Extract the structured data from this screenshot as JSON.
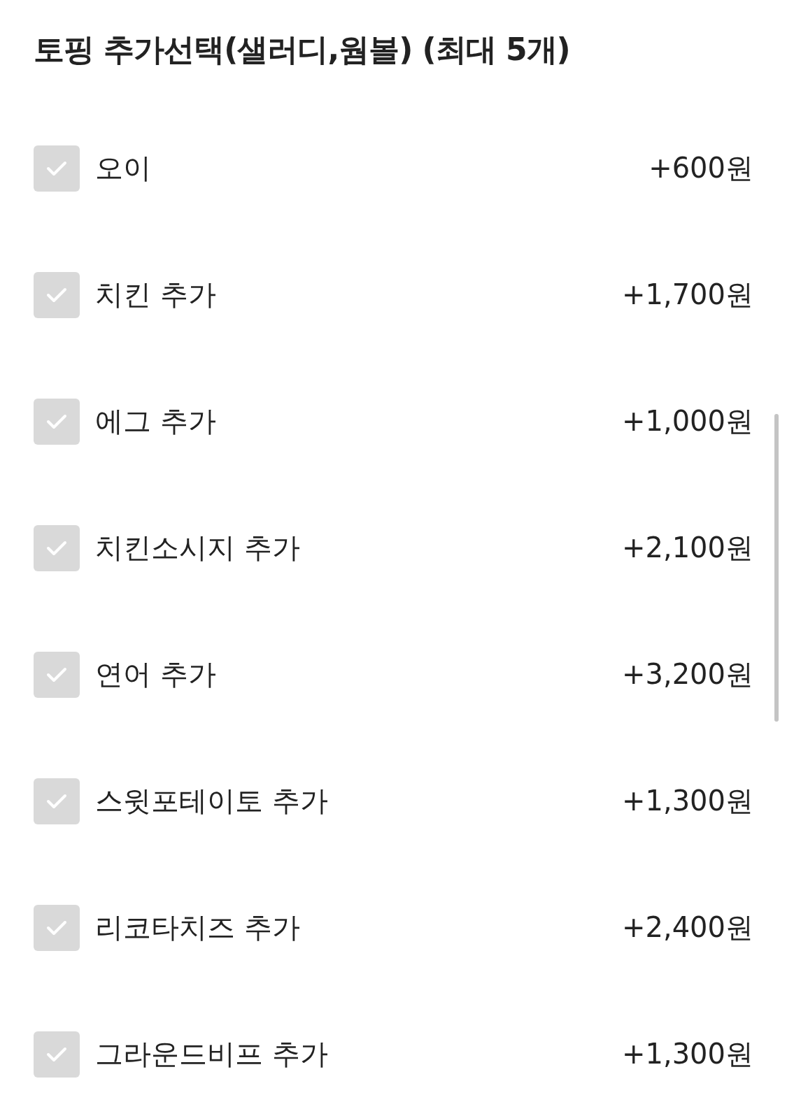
{
  "title": "토핑 추가선택(샐러디,웜볼) (최대 5개)",
  "options": [
    {
      "label": "오이",
      "price": "+600원",
      "checked": false
    },
    {
      "label": "치킨 추가",
      "price": "+1,700원",
      "checked": false
    },
    {
      "label": "에그 추가",
      "price": "+1,000원",
      "checked": false
    },
    {
      "label": "치킨소시지 추가",
      "price": "+2,100원",
      "checked": false
    },
    {
      "label": "연어 추가",
      "price": "+3,200원",
      "checked": false
    },
    {
      "label": "스윗포테이토 추가",
      "price": "+1,300원",
      "checked": false
    },
    {
      "label": "리코타치즈 추가",
      "price": "+2,400원",
      "checked": false
    },
    {
      "label": "그라운드비프 추가",
      "price": "+1,300원",
      "checked": false
    }
  ]
}
